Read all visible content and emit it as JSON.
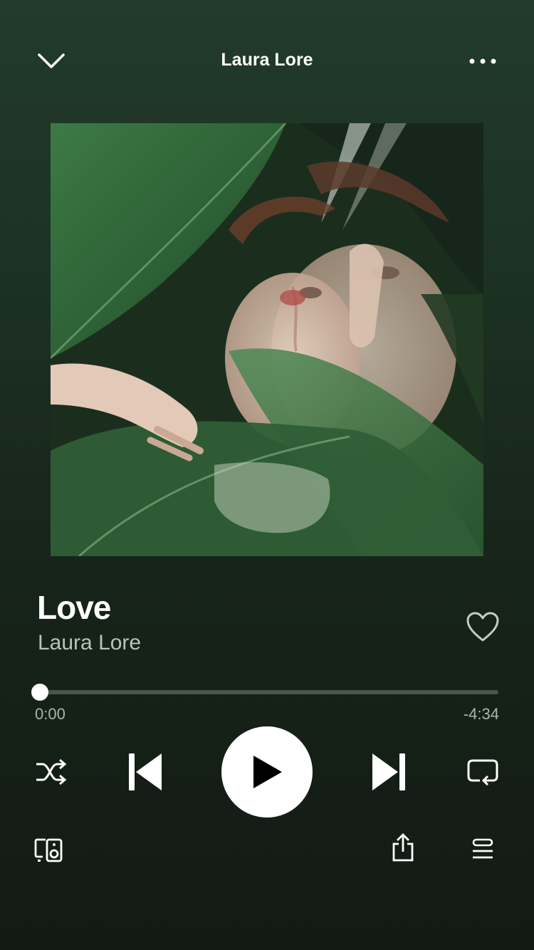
{
  "header": {
    "title": "Laura Lore",
    "collapse_icon": "chevron-down-icon",
    "more_icon": "more-dots-icon"
  },
  "album_art": {
    "description_icon": "album-art-image"
  },
  "track": {
    "title": "Love",
    "artist": "Laura Lore",
    "liked": false
  },
  "playback": {
    "elapsed": "0:00",
    "remaining": "-4:34",
    "progress": 0.0
  },
  "controls": {
    "shuffle_icon": "shuffle-icon",
    "previous_icon": "skip-back-icon",
    "play_icon": "play-icon",
    "next_icon": "skip-forward-icon",
    "repeat_icon": "repeat-icon"
  },
  "footer": {
    "devices_icon": "devices-icon",
    "share_icon": "share-icon",
    "queue_icon": "queue-icon"
  },
  "colors": {
    "background_top": "#223b2a",
    "background_bottom": "#121a14",
    "accent": "#ffffff",
    "muted": "#b7c3b8"
  }
}
